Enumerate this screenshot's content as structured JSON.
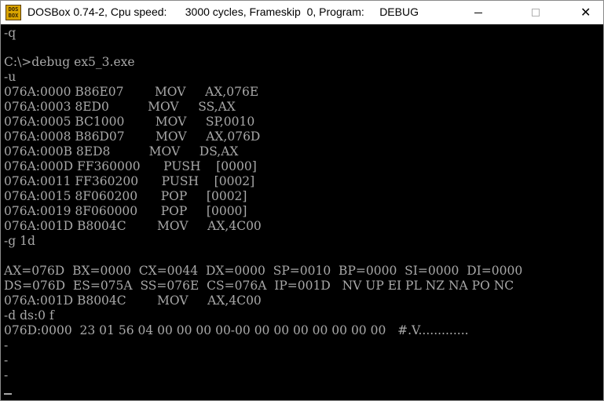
{
  "window": {
    "icon_text": "DOS BOX",
    "title": "DOSBox 0.74-2, Cpu speed:      3000 cycles, Frameskip  0, Program:     DEBUG",
    "buttons": {
      "minimize": "minimize",
      "maximize": "maximize",
      "close": "✕"
    }
  },
  "console": {
    "lines": [
      "-q",
      "",
      "C:\\>debug ex5_3.exe",
      "-u",
      "076A:0000 B86E07        MOV     AX,076E",
      "076A:0003 8ED0          MOV     SS,AX",
      "076A:0005 BC1000        MOV     SP,0010",
      "076A:0008 B86D07        MOV     AX,076D",
      "076A:000B 8ED8          MOV     DS,AX",
      "076A:000D FF360000      PUSH    [0000]",
      "076A:0011 FF360200      PUSH    [0002]",
      "076A:0015 8F060200      POP     [0002]",
      "076A:0019 8F060000      POP     [0000]",
      "076A:001D B8004C        MOV     AX,4C00",
      "-g 1d",
      "",
      "AX=076D  BX=0000  CX=0044  DX=0000  SP=0010  BP=0000  SI=0000  DI=0000",
      "DS=076D  ES=075A  SS=076E  CS=076A  IP=001D   NV UP EI PL NZ NA PO NC",
      "076A:001D B8004C        MOV     AX,4C00",
      "-d ds:0 f",
      "076D:0000  23 01 56 04 00 00 00 00-00 00 00 00 00 00 00 00   #.V.............",
      "-",
      "-",
      "-"
    ]
  },
  "colors": {
    "console_bg": "#000000",
    "console_text": "#a8a8a8",
    "titlebar_bg": "#ffffff"
  }
}
